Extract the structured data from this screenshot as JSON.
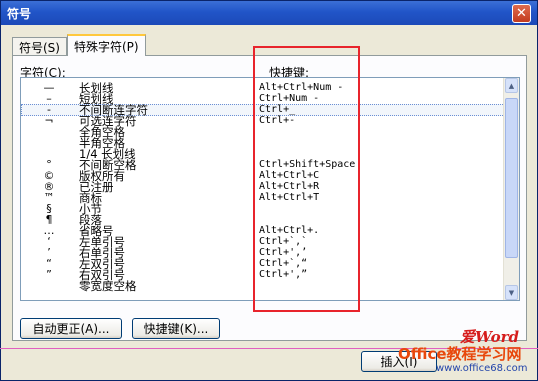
{
  "window": {
    "title": "符号",
    "close_glyph": "✕"
  },
  "tabs": [
    {
      "label": "符号(S)",
      "active": false
    },
    {
      "label": "特殊字符(P)",
      "active": true
    }
  ],
  "list": {
    "col_char": "字符(C):",
    "col_shortcut": "快捷键:",
    "rows": [
      {
        "symbol": "—",
        "name": "长划线",
        "shortcut": "Alt+Ctrl+Num -"
      },
      {
        "symbol": "–",
        "name": "短划线",
        "shortcut": "Ctrl+Num -"
      },
      {
        "symbol": "-",
        "name": "不间断连字符",
        "shortcut": "Ctrl+_",
        "selected": true
      },
      {
        "symbol": "¬",
        "name": "可选连字符",
        "shortcut": "Ctrl+-"
      },
      {
        "symbol": "",
        "name": "全角空格",
        "shortcut": ""
      },
      {
        "symbol": "",
        "name": "半角空格",
        "shortcut": ""
      },
      {
        "symbol": "",
        "name": "1/4 长划线",
        "shortcut": ""
      },
      {
        "symbol": "°",
        "name": "不间断空格",
        "shortcut": "Ctrl+Shift+Space"
      },
      {
        "symbol": "©",
        "name": "版权所有",
        "shortcut": "Alt+Ctrl+C"
      },
      {
        "symbol": "®",
        "name": "已注册",
        "shortcut": "Alt+Ctrl+R"
      },
      {
        "symbol": "™",
        "name": "商标",
        "shortcut": "Alt+Ctrl+T"
      },
      {
        "symbol": "§",
        "name": "小节",
        "shortcut": ""
      },
      {
        "symbol": "¶",
        "name": "段落",
        "shortcut": ""
      },
      {
        "symbol": "…",
        "name": "省略号",
        "shortcut": "Alt+Ctrl+."
      },
      {
        "symbol": "‘",
        "name": "左单引号",
        "shortcut": "Ctrl+`,`"
      },
      {
        "symbol": "’",
        "name": "右单引号",
        "shortcut": "Ctrl+',’"
      },
      {
        "symbol": "“",
        "name": "左双引号",
        "shortcut": "Ctrl+`,“"
      },
      {
        "symbol": "”",
        "name": "右双引号",
        "shortcut": "Ctrl+',”"
      },
      {
        "symbol": "",
        "name": "零宽度空格",
        "shortcut": ""
      }
    ]
  },
  "buttons": {
    "autocorrect": "自动更正(A)...",
    "shortcut_key": "快捷键(K)...",
    "insert": "插入(I)"
  },
  "scrollbar": {
    "up_glyph": "▲",
    "down_glyph": "▼"
  },
  "watermark": {
    "line1": "爱Word",
    "line2": "Office教程学习网",
    "line3": "www.office68.com"
  }
}
